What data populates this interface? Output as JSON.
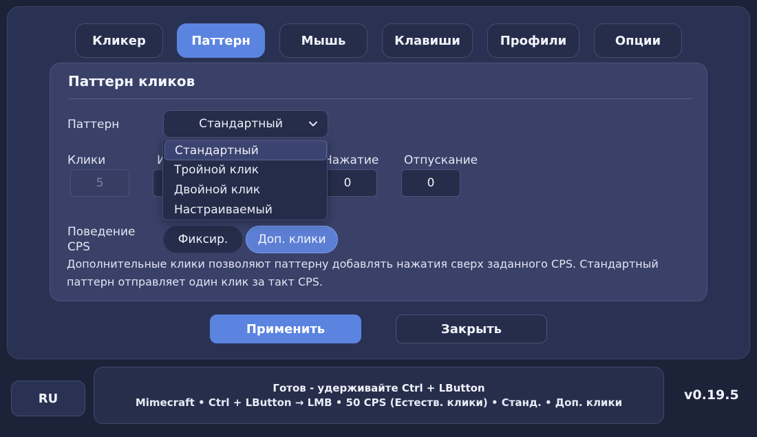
{
  "tabs": [
    {
      "label": "Кликер"
    },
    {
      "label": "Паттерн"
    },
    {
      "label": "Мышь"
    },
    {
      "label": "Клавиши"
    },
    {
      "label": "Профили"
    },
    {
      "label": "Опции"
    }
  ],
  "active_tab": "Паттерн",
  "card": {
    "title": "Паттерн кликов",
    "pattern_label": "Паттерн",
    "pattern_value": "Стандартный",
    "clicks_label": "Клики",
    "clicks_value": "5",
    "interval_label_partial": "И",
    "press_label": "Нажатие",
    "press_value": "0",
    "release_label": "Отпускание",
    "release_value": "0",
    "behavior_label": "Поведение CPS",
    "behavior_fixed": "Фиксир.",
    "behavior_extra": "Доп. клики",
    "description": "Дополнительные клики позволяют паттерну добавлять нажатия сверх заданного CPS. Стандартный паттерн отправляет один клик за такт CPS."
  },
  "dropdown": {
    "options": [
      "Стандартный",
      "Тройной клик",
      "Двойной клик",
      "Настраиваемый"
    ],
    "selected": "Стандартный"
  },
  "actions": {
    "apply": "Применить",
    "close": "Закрыть"
  },
  "footer": {
    "language": "RU",
    "status_title": "Готов - удерживайте Ctrl + LButton",
    "status_detail": "Mimecraft  •  Ctrl + LButton → LMB  •  50 CPS (Естеств. клики)  •  Станд.  •  Доп. клики",
    "version": "v0.19.5"
  },
  "colors": {
    "accent": "#5b84e0",
    "background": "#1c2339",
    "panel": "#2a3253",
    "card": "#394169"
  }
}
